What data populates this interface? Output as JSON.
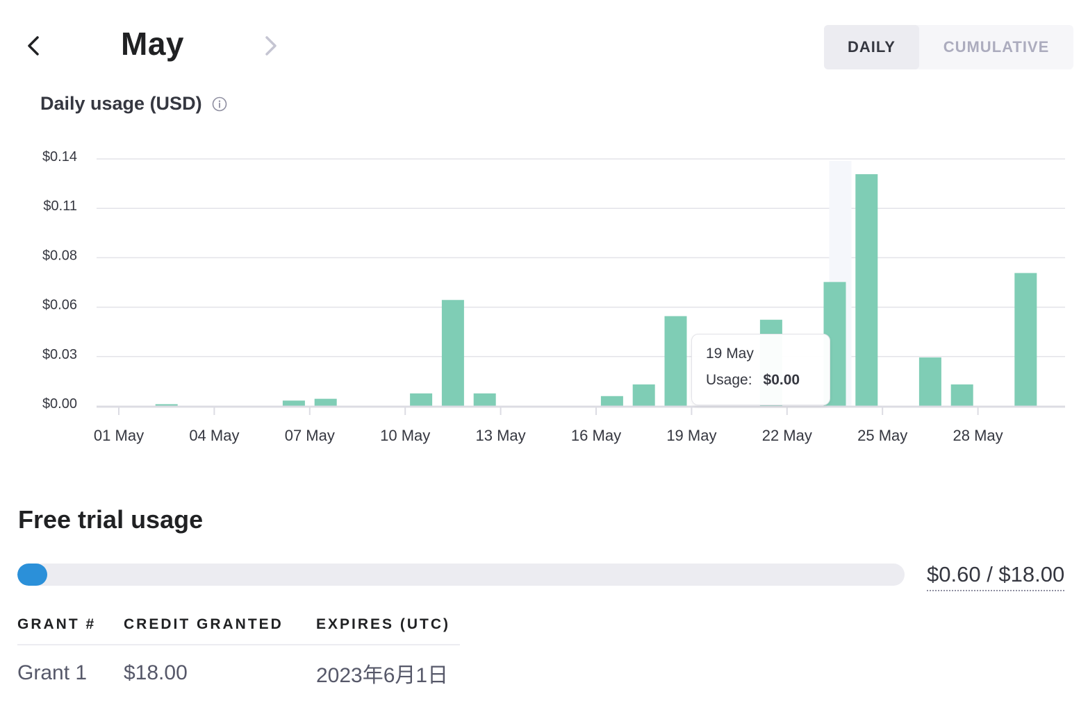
{
  "header": {
    "month": "May",
    "prev_icon": "chevron-left-icon",
    "next_icon": "chevron-right-icon",
    "toggle": {
      "options": [
        "DAILY",
        "CUMULATIVE"
      ],
      "selected": "DAILY"
    }
  },
  "chart_title": "Daily usage (USD)",
  "info_icon": "info-icon",
  "colors": {
    "bar": "#7fcdb5",
    "hover_band": "#f5f7fb",
    "progress": "#2b90d9",
    "track": "#ececf1"
  },
  "chart_data": {
    "type": "bar",
    "title": "Daily usage (USD)",
    "xlabel": "",
    "ylabel": "",
    "ylim": [
      0,
      0.1375
    ],
    "grid": true,
    "y_ticks": [
      0,
      0.0275,
      0.055,
      0.0825,
      0.11,
      0.1375
    ],
    "y_tick_labels": [
      "$0.00",
      "$0.03",
      "$0.06",
      "$0.08",
      "$0.11",
      "$0.14"
    ],
    "x_tick_labels": [
      "01 May",
      "04 May",
      "07 May",
      "10 May",
      "13 May",
      "16 May",
      "19 May",
      "22 May",
      "25 May",
      "28 May"
    ],
    "x_tick_days": [
      1,
      4,
      7,
      10,
      13,
      16,
      19,
      22,
      25,
      28
    ],
    "categories": [
      "01 May",
      "02 May",
      "03 May",
      "04 May",
      "05 May",
      "06 May",
      "07 May",
      "08 May",
      "09 May",
      "10 May",
      "11 May",
      "12 May",
      "13 May",
      "14 May",
      "15 May",
      "16 May",
      "17 May",
      "18 May",
      "19 May",
      "20 May",
      "21 May",
      "22 May",
      "23 May",
      "24 May",
      "25 May",
      "26 May",
      "27 May",
      "28 May",
      "29 May",
      "30 May",
      "31 May"
    ],
    "values": [
      0,
      0.001,
      0,
      0,
      0,
      0.003,
      0.004,
      0,
      0,
      0.007,
      0.059,
      0.007,
      0,
      0,
      0,
      0.0055,
      0.012,
      0.05,
      0,
      0,
      0.048,
      0,
      0.069,
      0.129,
      0,
      0.027,
      0.012,
      0,
      0.074,
      0,
      0
    ],
    "highlighted_day": "24 May"
  },
  "tooltip": {
    "date": "19 May",
    "label": "Usage:",
    "value": "$0.00"
  },
  "free_trial": {
    "title": "Free trial usage",
    "used": 0.6,
    "total": 18.0,
    "fraction": 0.0333,
    "label": "$0.60 / $18.00"
  },
  "grants": {
    "columns": [
      "GRANT #",
      "CREDIT GRANTED",
      "EXPIRES (UTC)"
    ],
    "rows": [
      [
        "Grant 1",
        "$18.00",
        "2023年6月1日"
      ]
    ]
  }
}
